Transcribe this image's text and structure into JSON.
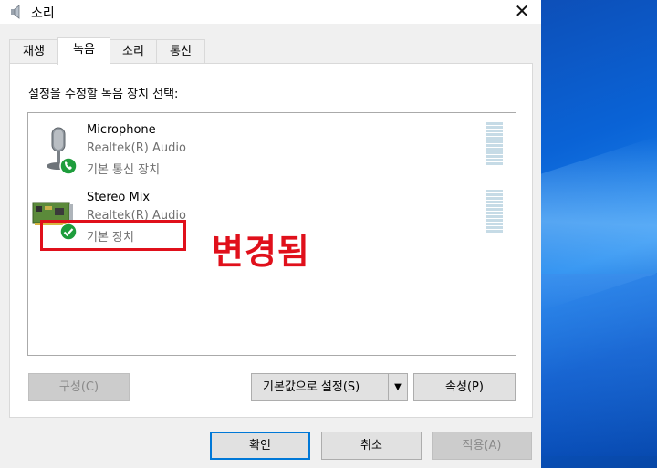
{
  "window": {
    "title": "소리",
    "close_glyph": "✕"
  },
  "tabs": [
    {
      "label": "재생",
      "active": false
    },
    {
      "label": "녹음",
      "active": true
    },
    {
      "label": "소리",
      "active": false
    },
    {
      "label": "통신",
      "active": false
    }
  ],
  "instruction": "설정을 수정할 녹음 장치 선택:",
  "devices": [
    {
      "name": "Microphone",
      "driver": "Realtek(R) Audio",
      "status": "기본 통신 장치",
      "icon": "microphone-icon",
      "badge": "phone-badge-icon"
    },
    {
      "name": "Stereo Mix",
      "driver": "Realtek(R) Audio",
      "status": "기본 장치",
      "icon": "sound-card-icon",
      "badge": "check-badge-icon"
    }
  ],
  "annotation": {
    "text": "변경됨",
    "color": "#e0101b"
  },
  "buttons": {
    "configure": "구성(C)",
    "set_default": "기본값으로 설정(S)",
    "set_default_arrow": "▼",
    "properties": "속성(P)",
    "ok": "확인",
    "cancel": "취소",
    "apply": "적용(A)"
  },
  "colors": {
    "accent": "#0078d7",
    "status_green": "#1e9d3c",
    "meter": "#c6dbe6",
    "annotation_red": "#e0101b"
  }
}
